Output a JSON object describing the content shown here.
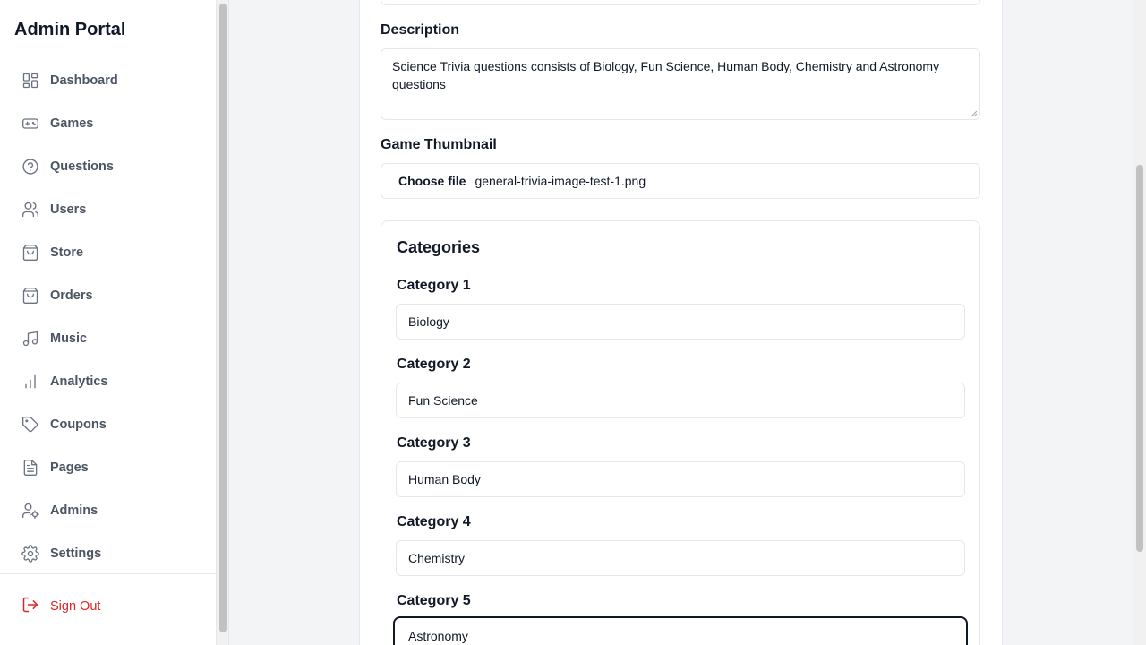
{
  "sidebar": {
    "brand": "Admin Portal",
    "items": [
      {
        "label": "Dashboard",
        "icon": "dashboard-icon"
      },
      {
        "label": "Games",
        "icon": "gamepad-icon"
      },
      {
        "label": "Questions",
        "icon": "help-circle-icon"
      },
      {
        "label": "Users",
        "icon": "users-icon"
      },
      {
        "label": "Store",
        "icon": "shopping-bag-icon"
      },
      {
        "label": "Orders",
        "icon": "shopping-bag-icon"
      },
      {
        "label": "Music",
        "icon": "music-icon"
      },
      {
        "label": "Analytics",
        "icon": "bar-chart-icon"
      },
      {
        "label": "Coupons",
        "icon": "tag-icon"
      },
      {
        "label": "Pages",
        "icon": "file-text-icon"
      },
      {
        "label": "Admins",
        "icon": "user-cog-icon"
      },
      {
        "label": "Settings",
        "icon": "gear-icon"
      }
    ],
    "signout": "Sign Out"
  },
  "form": {
    "description_label": "Description",
    "description_value": "Science Trivia questions consists of Biology, Fun Science, Human Body, Chemistry and Astronomy questions",
    "thumbnail_label": "Game Thumbnail",
    "file_button": "Choose file",
    "file_name": "general-trivia-image-test-1.png",
    "categories_title": "Categories",
    "categories": [
      {
        "label": "Category 1",
        "value": "Biology"
      },
      {
        "label": "Category 2",
        "value": "Fun Science"
      },
      {
        "label": "Category 3",
        "value": "Human Body"
      },
      {
        "label": "Category 4",
        "value": "Chemistry"
      },
      {
        "label": "Category 5",
        "value": "Astronomy"
      }
    ]
  },
  "colors": {
    "accent": "#111827",
    "danger": "#dc2626",
    "muted": "#4b5563"
  }
}
